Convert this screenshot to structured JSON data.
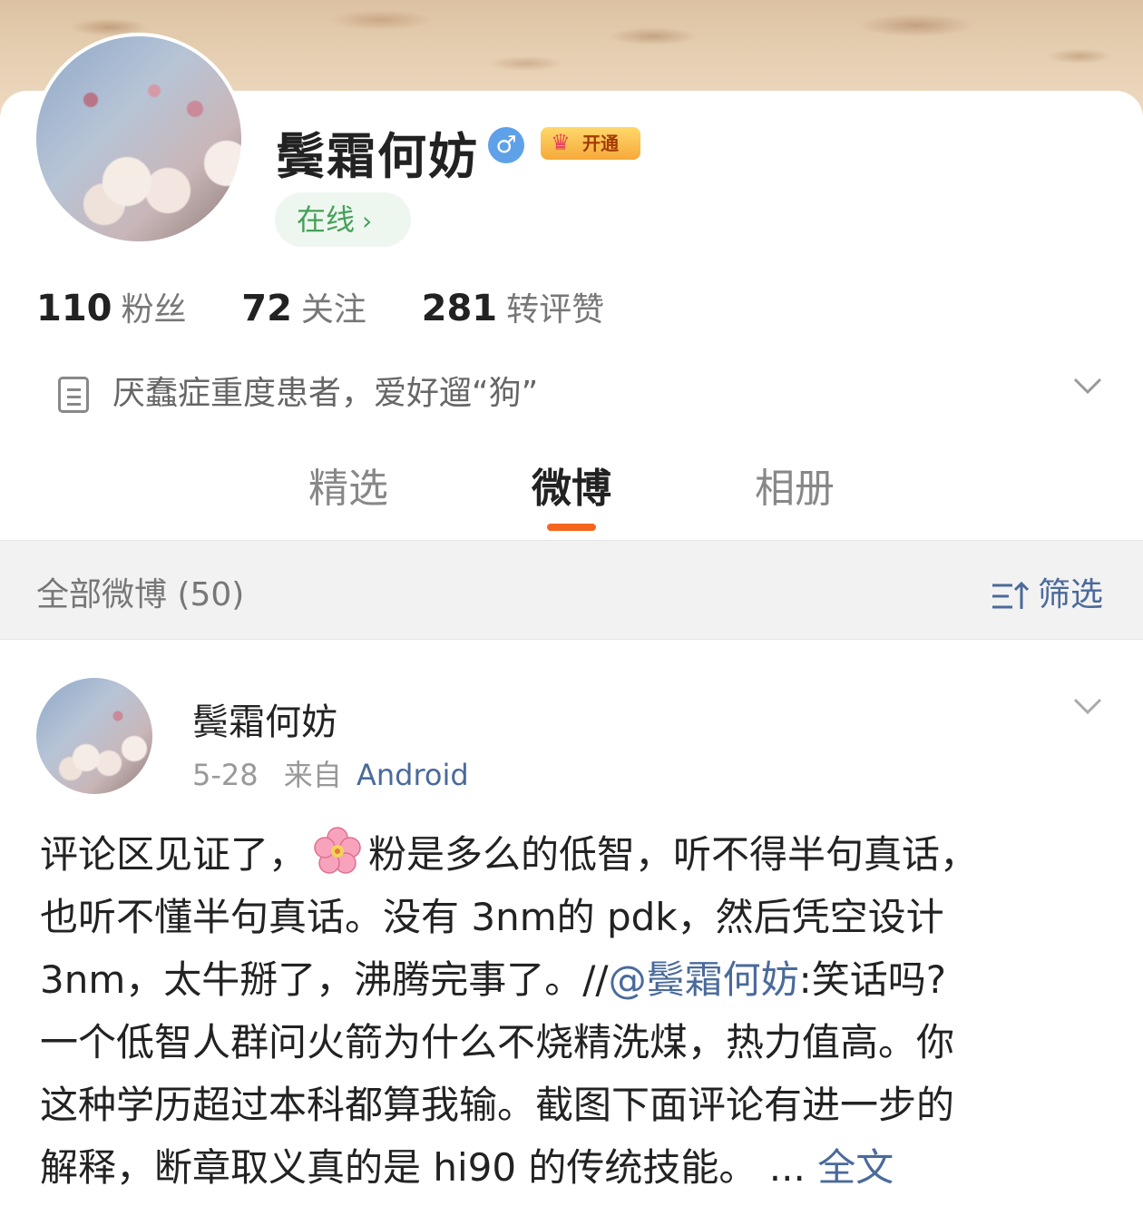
{
  "profile": {
    "name": "鬓霜何妨",
    "gender_symbol": "♂",
    "vip_label": "开通",
    "online_label": "在线",
    "stats": [
      {
        "value": "110",
        "label": "粉丝"
      },
      {
        "value": "72",
        "label": "关注"
      },
      {
        "value": "281",
        "label": "转评赞"
      }
    ],
    "bio": "厌蠢症重度患者，爱好遛“狗”"
  },
  "tabs": [
    {
      "label": "精选",
      "active": false
    },
    {
      "label": "微博",
      "active": true
    },
    {
      "label": "相册",
      "active": false
    }
  ],
  "filter_bar": {
    "title": "全部微博 (50)",
    "filter_label": "筛选"
  },
  "post": {
    "author": "鬓霜何妨",
    "date": "5-28",
    "source_prefix": "来自",
    "source": "Android",
    "body_lines": [
      {
        "before": "评论区见证了，",
        "icon": "cherry-blossom-icon",
        "after": "粉是多么的低智，听不得半句真话，"
      },
      {
        "text": "也听不懂半句真话。没有 3nm的 pdk，然后凭空设计"
      },
      {
        "text": " 3nm，太牛掰了，沸腾完事了。//",
        "mention": "@鬓霜何妨",
        "after": ":笑话吗?"
      },
      {
        "text": "一个低智人群问火箭为什么不烧精洗煤，热力值高。你"
      },
      {
        "text": "这种学历超过本科都算我输。截图下面评论有进一步的"
      },
      {
        "text": "解释，断章取义真的是 hi90 的传统技能。 ... ",
        "link": "全文"
      }
    ]
  },
  "colors": {
    "accent_orange": "#f5651e",
    "link_blue": "#4a6a9b",
    "online_green": "#46a05a"
  }
}
